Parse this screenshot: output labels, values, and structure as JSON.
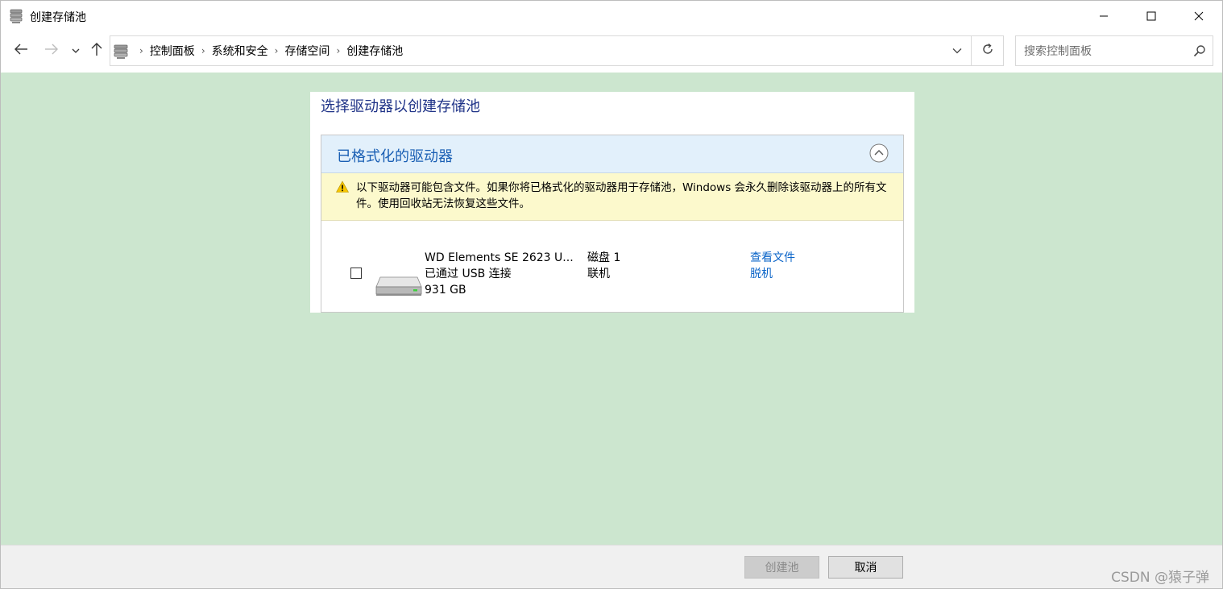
{
  "window": {
    "title": "创建存储池",
    "controls": {
      "minimize_icon": "minimize-icon",
      "maximize_icon": "maximize-icon",
      "close_icon": "close-icon"
    }
  },
  "navigation": {
    "back_icon": "arrow-left-icon",
    "forward_icon": "arrow-right-icon",
    "recent_icon": "chevron-down-icon",
    "up_icon": "arrow-up-icon",
    "breadcrumbs": [
      "控制面板",
      "系统和安全",
      "存储空间",
      "创建存储池"
    ],
    "search_placeholder": "搜索控制面板"
  },
  "main": {
    "heading": "选择驱动器以创建存储池",
    "group": {
      "title": "已格式化的驱动器",
      "warning": "以下驱动器可能包含文件。如果你将已格式化的驱动器用于存储池，Windows 会永久删除该驱动器上的所有文件。使用回收站无法恢复这些文件。",
      "drive": {
        "name": "WD Elements SE 2623 U...",
        "connection": "已通过 USB 连接",
        "size": "931 GB",
        "disk": "磁盘 1",
        "status": "联机",
        "link_view_files": "查看文件",
        "link_offline": "脱机",
        "checked": false
      }
    }
  },
  "footer": {
    "create_button": "创建池",
    "cancel_button": "取消",
    "watermark": "CSDN @猿子弹"
  },
  "colors": {
    "main_background": "#cce6cf",
    "heading": "#1e3287",
    "group_header_bg": "#e2f0fb",
    "group_title": "#1a5fb4",
    "warning_bg": "#fcf9cc",
    "link": "#0a64c8"
  }
}
